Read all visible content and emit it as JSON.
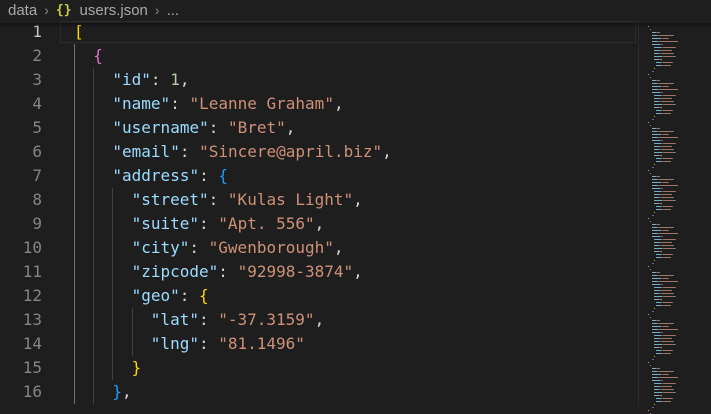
{
  "breadcrumb": {
    "folder": "data",
    "file_icon": "{}",
    "file": "users.json",
    "more": "..."
  },
  "editor": {
    "line_numbers": [
      "1",
      "2",
      "3",
      "4",
      "5",
      "6",
      "7",
      "8",
      "9",
      "10",
      "11",
      "12",
      "13",
      "14",
      "15",
      "16"
    ],
    "active_line": 1,
    "lines": [
      [
        [
          "[",
          "b1"
        ]
      ],
      [
        [
          "{",
          "b2"
        ]
      ],
      [
        [
          "\"id\"",
          "k"
        ],
        [
          ": ",
          "p"
        ],
        [
          "1",
          "n"
        ],
        [
          ",",
          "p"
        ]
      ],
      [
        [
          "\"name\"",
          "k"
        ],
        [
          ": ",
          "p"
        ],
        [
          "\"Leanne Graham\"",
          "s"
        ],
        [
          ",",
          "p"
        ]
      ],
      [
        [
          "\"username\"",
          "k"
        ],
        [
          ": ",
          "p"
        ],
        [
          "\"Bret\"",
          "s"
        ],
        [
          ",",
          "p"
        ]
      ],
      [
        [
          "\"email\"",
          "k"
        ],
        [
          ": ",
          "p"
        ],
        [
          "\"Sincere@april.biz\"",
          "s"
        ],
        [
          ",",
          "p"
        ]
      ],
      [
        [
          "\"address\"",
          "k"
        ],
        [
          ": ",
          "p"
        ],
        [
          "{",
          "b3"
        ]
      ],
      [
        [
          "\"street\"",
          "k"
        ],
        [
          ": ",
          "p"
        ],
        [
          "\"Kulas Light\"",
          "s"
        ],
        [
          ",",
          "p"
        ]
      ],
      [
        [
          "\"suite\"",
          "k"
        ],
        [
          ": ",
          "p"
        ],
        [
          "\"Apt. 556\"",
          "s"
        ],
        [
          ",",
          "p"
        ]
      ],
      [
        [
          "\"city\"",
          "k"
        ],
        [
          ": ",
          "p"
        ],
        [
          "\"Gwenborough\"",
          "s"
        ],
        [
          ",",
          "p"
        ]
      ],
      [
        [
          "\"zipcode\"",
          "k"
        ],
        [
          ": ",
          "p"
        ],
        [
          "\"92998-3874\"",
          "s"
        ],
        [
          ",",
          "p"
        ]
      ],
      [
        [
          "\"geo\"",
          "k"
        ],
        [
          ": ",
          "p"
        ],
        [
          "{",
          "b1"
        ]
      ],
      [
        [
          "\"lat\"",
          "k"
        ],
        [
          ": ",
          "p"
        ],
        [
          "\"-37.3159\"",
          "s"
        ],
        [
          ",",
          "p"
        ]
      ],
      [
        [
          "\"lng\"",
          "k"
        ],
        [
          ": ",
          "p"
        ],
        [
          "\"81.1496\"",
          "s"
        ]
      ],
      [
        [
          "}",
          "b1"
        ]
      ],
      [
        [
          "}",
          "b3"
        ],
        [
          ",",
          "p"
        ]
      ]
    ],
    "indents": [
      0,
      1,
      2,
      2,
      2,
      2,
      2,
      3,
      3,
      3,
      3,
      3,
      4,
      4,
      3,
      2
    ]
  },
  "colors": {
    "background": "#1e1e1e",
    "key": "#9cdcfe",
    "string": "#ce9178",
    "number": "#b5cea8",
    "bracket_level1": "#ffd700",
    "bracket_level2": "#da70d6",
    "bracket_level3": "#179fff"
  }
}
